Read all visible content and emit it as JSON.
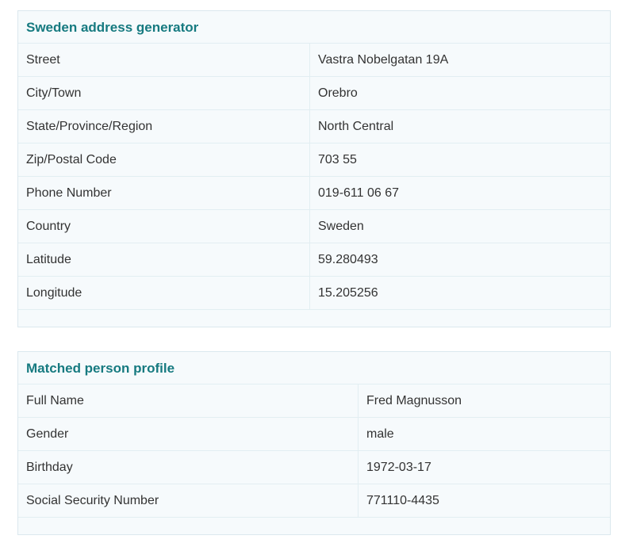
{
  "address": {
    "title": "Sweden address generator",
    "rows": [
      {
        "label": "Street",
        "value": "Vastra Nobelgatan 19A"
      },
      {
        "label": "City/Town",
        "value": "Orebro"
      },
      {
        "label": "State/Province/Region",
        "value": "North Central"
      },
      {
        "label": "Zip/Postal Code",
        "value": "703 55"
      },
      {
        "label": "Phone Number",
        "value": "019-611 06 67"
      },
      {
        "label": "Country",
        "value": "Sweden"
      },
      {
        "label": "Latitude",
        "value": "59.280493"
      },
      {
        "label": "Longitude",
        "value": "15.205256"
      }
    ]
  },
  "person": {
    "title": "Matched person profile",
    "rows": [
      {
        "label": "Full Name",
        "value": "Fred Magnusson"
      },
      {
        "label": "Gender",
        "value": "male"
      },
      {
        "label": "Birthday",
        "value": "1972-03-17"
      },
      {
        "label": "Social Security Number",
        "value": "771110-4435"
      }
    ]
  },
  "colors": {
    "title": "#167a80",
    "panel_bg": "#f6fafc",
    "border": "#dbe8ee",
    "text": "#333333"
  }
}
